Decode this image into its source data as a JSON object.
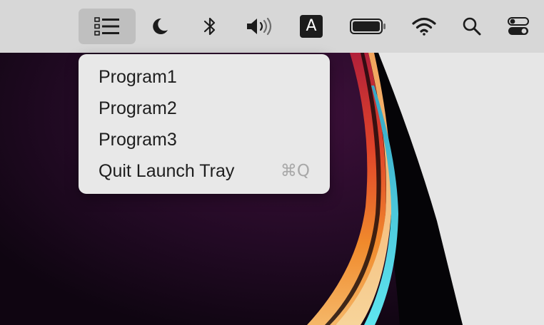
{
  "menubar": {
    "items": [
      {
        "name": "launch-tray-icon"
      },
      {
        "name": "moon-icon"
      },
      {
        "name": "bluetooth-icon"
      },
      {
        "name": "volume-icon"
      },
      {
        "name": "font-icon",
        "label": "A"
      },
      {
        "name": "battery-icon"
      },
      {
        "name": "wifi-icon"
      },
      {
        "name": "search-icon"
      },
      {
        "name": "control-center-icon"
      }
    ]
  },
  "menu": {
    "items": [
      {
        "label": "Program1"
      },
      {
        "label": "Program2"
      },
      {
        "label": "Program3"
      },
      {
        "label": "Quit Launch Tray",
        "shortcut": "⌘Q"
      }
    ]
  },
  "colors": {
    "menubar": "#d7d7d7",
    "active_item": "#bfbfbf",
    "menu_background": "#e8e8e8",
    "shortcut_text": "#a8a8a8"
  }
}
